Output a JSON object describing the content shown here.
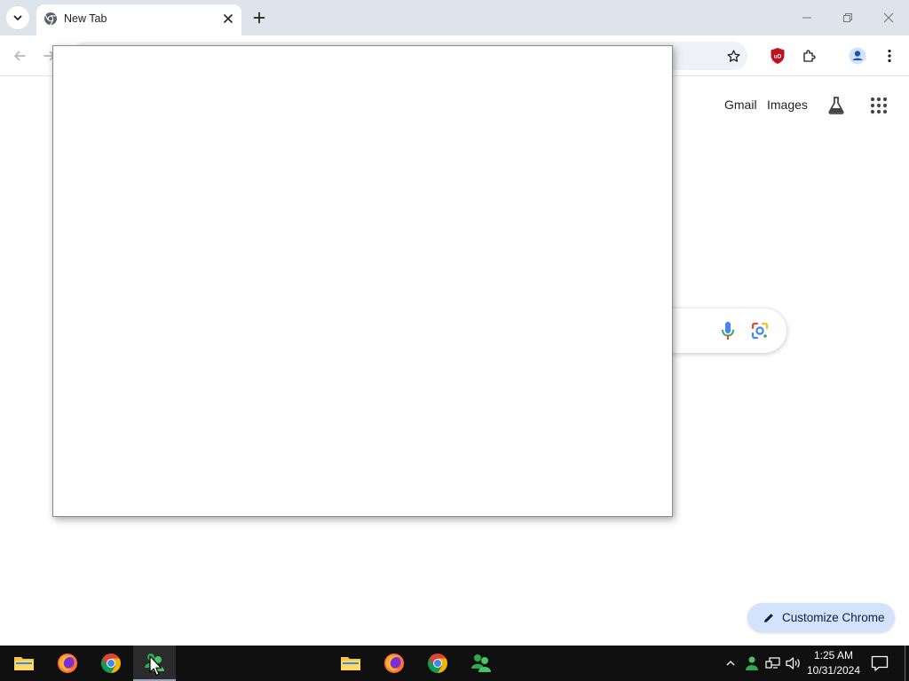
{
  "browser": {
    "tab": {
      "title": "New Tab",
      "favicon": "chrome-icon",
      "close_icon": "close-icon"
    },
    "buttons": {
      "tab_search": "chevron-down-icon",
      "new_tab": "plus-icon",
      "minimize": "minimize-icon",
      "restore": "restore-icon",
      "close": "close-icon"
    },
    "toolbar": {
      "back": "arrow-left-icon",
      "forward": "arrow-right-icon",
      "bookmark": "star-icon",
      "extension_ublock": "ublock-origin-icon",
      "extensions": "puzzle-icon",
      "profile": "profile-icon",
      "menu": "kebab-menu-icon"
    }
  },
  "ntp": {
    "links": {
      "gmail": "Gmail",
      "images": "Images"
    },
    "icons": {
      "labs": "flask-icon",
      "apps": "apps-grid-icon",
      "voice": "mic-icon",
      "lens": "google-lens-icon"
    },
    "customize_label": "Customize Chrome",
    "customize_icon": "pencil-icon"
  },
  "taskbar": {
    "apps": [
      {
        "name": "File Explorer",
        "icon": "folder-icon"
      },
      {
        "name": "Firefox",
        "icon": "firefox-icon"
      },
      {
        "name": "Chrome",
        "icon": "chrome-icon"
      },
      {
        "name": "Messenger",
        "icon": "people-icon"
      },
      {
        "name": "File Explorer",
        "icon": "folder-icon"
      },
      {
        "name": "Firefox",
        "icon": "firefox-icon"
      },
      {
        "name": "Chrome",
        "icon": "chrome-icon"
      },
      {
        "name": "Messenger",
        "icon": "people-icon"
      }
    ],
    "tray": {
      "time": "1:25 AM",
      "date": "10/31/2024"
    }
  },
  "colors": {
    "tabstrip": "#dfe3eb",
    "taskbar": "#101010",
    "customize_bg": "#d3e3fd",
    "ublock_red": "#c0111f"
  }
}
